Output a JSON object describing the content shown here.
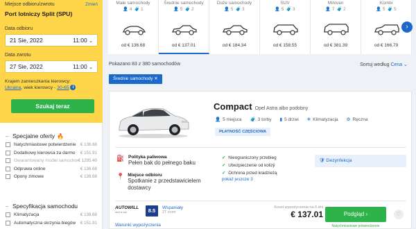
{
  "search": {
    "location_label": "Miejsce odbioru/zwrotu",
    "change_link": "Zmień",
    "location_value": "Port lotniczy Split (SPU)",
    "pickup_label": "Data odbioru",
    "pickup_date": "21  Sie, 2022",
    "pickup_time": "11:00",
    "return_label": "Data zwrotu",
    "return_date": "27  Sie, 2022",
    "return_time": "11:00",
    "residence_text": "Krajem zamieszkania kierowcy:",
    "residence_country": "Ukraina",
    "driver_age_text": ", wiek kierowcy -",
    "driver_age": "30-65",
    "search_button": "Szukaj teraz"
  },
  "offers": {
    "title": "Specjalne oferty",
    "items": [
      {
        "label": "Natychmiastowe potwierdzenie",
        "price": "€ 136.68",
        "dim": false
      },
      {
        "label": "Dodatkowy kierowca za darmo",
        "price": "€ 151.91",
        "dim": false
      },
      {
        "label": "Gwarantowany model samochodu",
        "price": "€ 1295.40",
        "dim": true
      },
      {
        "label": "Odprawa online",
        "price": "€ 136.68",
        "dim": false
      },
      {
        "label": "Opony zimowe",
        "price": "€ 136.68",
        "dim": false
      }
    ]
  },
  "specs_section": {
    "title": "Specyfikacja samochodu",
    "items": [
      {
        "label": "Klimatyzacja",
        "price": "€ 136.68"
      },
      {
        "label": "Automatyczna skrzynia biegów",
        "price": "€ 151.91"
      }
    ]
  },
  "categories": [
    {
      "name": "Małe samochody",
      "seats": "4",
      "bags": "1",
      "price": "od € 136.68",
      "active": false
    },
    {
      "name": "Średnie samochody",
      "seats": "5",
      "bags": "2",
      "price": "od € 137.01",
      "active": true
    },
    {
      "name": "Duże samochody",
      "seats": "5",
      "bags": "3",
      "price": "od € 184.34",
      "active": false
    },
    {
      "name": "SUV",
      "seats": "5",
      "bags": "3",
      "price": "od € 158.55",
      "active": false
    },
    {
      "name": "Minivan",
      "seats": "7",
      "bags": "2",
      "price": "od € 381.39",
      "active": false
    },
    {
      "name": "Kombi",
      "seats": "5",
      "bags": "5",
      "price": "od € 166.79",
      "active": false
    }
  ],
  "results": {
    "count_text": "Pokazano 83 z 380 samochodów",
    "sort_label": "Sortuj według",
    "sort_value": "Cena",
    "active_filter": "Średnie samochody"
  },
  "card": {
    "model": "Compact",
    "model_sub": "Opel Astra albo podobny",
    "seats": "5 miejsca",
    "bags": "3 torby",
    "doors": "5 drzwi",
    "ac": "Klimatyzacja",
    "gearbox": "Ręczna",
    "badge": "PŁATNOŚĆ CZĘŚCIOWA",
    "fuel_title": "Polityka paliwowa",
    "fuel_value": "Pełen bak do pełnego baku",
    "pickup_title": "Miejsce odbioru",
    "pickup_value": "Spotkanie z przedstawicielem dostawcy",
    "features": [
      "Nieograniczony przebieg",
      "Ubezpieczenie od kolizji",
      "Ochrona przed kradzieżą"
    ],
    "more": "pokaż jeszcze 3",
    "disinfection": "Dezynfekcja",
    "supplier": "AUTOWILL",
    "supplier_sub": "rent a car",
    "rating": "8.5",
    "rating_text": "Wspaniały",
    "rating_count": "27 ocen",
    "conditions": "Warunki wypożyczenia",
    "price_label": "Koszt wypożyczenia na 6 dni",
    "price": "€ 137.01",
    "book_button": "Podgląd",
    "book_note": "Natychmiastowe potwierdzenie"
  }
}
